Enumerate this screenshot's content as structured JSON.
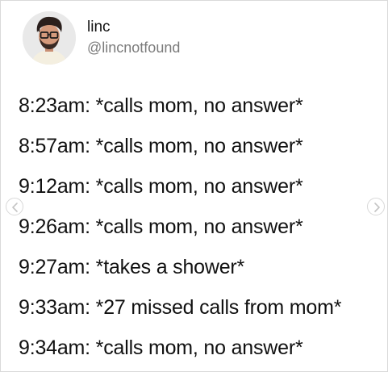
{
  "user": {
    "display_name": "linc",
    "handle": "@lincnotfound",
    "avatar_icon": "profile-avatar"
  },
  "tweet": {
    "lines": [
      "8:23am: *calls mom, no answer*",
      "8:57am: *calls mom, no answer*",
      "9:12am: *calls mom, no answer*",
      "9:26am: *calls mom, no answer*",
      "9:27am: *takes a shower*",
      "9:33am: *27 missed calls from mom*",
      "9:34am: *calls mom, no answer*"
    ]
  },
  "carousel": {
    "prev_icon": "chevron-left-icon",
    "next_icon": "chevron-right-icon"
  },
  "colors": {
    "text": "#111111",
    "handle": "#7b7b7b",
    "border": "#d9d9d9"
  }
}
